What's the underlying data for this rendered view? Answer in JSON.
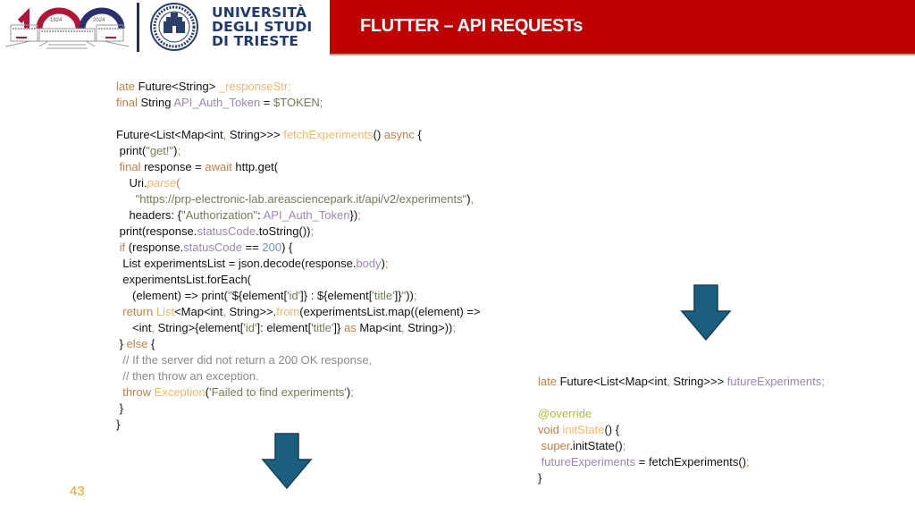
{
  "header": {
    "logo_years": {
      "start": "1924",
      "end": "2024"
    },
    "university_name": [
      "UNIVERSITÀ",
      "DEGLI STUDI",
      "DI TRIESTE"
    ],
    "slide_title": "FLUTTER – API REQUESTs",
    "title_bar_color": "#c00000"
  },
  "code_left": {
    "lines": [
      [
        {
          "t": "late",
          "c": "kw"
        },
        {
          "t": " Future<String> "
        },
        {
          "t": "_responseStr;",
          "c": "fn"
        }
      ],
      [
        {
          "t": "final",
          "c": "kw"
        },
        {
          "t": " String "
        },
        {
          "t": "API_Auth_Token",
          "c": "prop"
        },
        {
          "t": " = "
        },
        {
          "t": "$TOKEN;",
          "c": "str"
        }
      ],
      [
        {
          "t": ""
        }
      ],
      [
        {
          "t": "Future<List<Map<int"
        },
        {
          "t": ",",
          "c": "kw"
        },
        {
          "t": " String>>> "
        },
        {
          "t": "fetchExperiments",
          "c": "fn"
        },
        {
          "t": "() "
        },
        {
          "t": "async",
          "c": "kw"
        },
        {
          "t": " {"
        }
      ],
      [
        {
          "t": " print("
        },
        {
          "t": "\"get!\"",
          "c": "str"
        },
        {
          "t": ")"
        },
        {
          "t": ";",
          "c": "kw"
        }
      ],
      [
        {
          "t": " "
        },
        {
          "t": "final",
          "c": "kw"
        },
        {
          "t": " response = "
        },
        {
          "t": "await",
          "c": "kw"
        },
        {
          "t": " http.get("
        }
      ],
      [
        {
          "t": "    Uri."
        },
        {
          "t": "parse",
          "c": "fni"
        },
        {
          "t": "(",
          "c": "kw"
        }
      ],
      [
        {
          "t": "      "
        },
        {
          "t": "\"https://prp-electronic-lab.areasciencepark.it/api/v2/experiments\"",
          "c": "str"
        },
        {
          "t": ")"
        },
        {
          "t": ",",
          "c": "kw"
        }
      ],
      [
        {
          "t": "    headers: {"
        },
        {
          "t": "\"Authorization\"",
          "c": "str"
        },
        {
          "t": ": "
        },
        {
          "t": "API_Auth_Token",
          "c": "prop"
        },
        {
          "t": "})"
        },
        {
          "t": ";",
          "c": "kw"
        }
      ],
      [
        {
          "t": " print(response."
        },
        {
          "t": "statusCode",
          "c": "prop"
        },
        {
          "t": ".toString())"
        },
        {
          "t": ";",
          "c": "kw"
        }
      ],
      [
        {
          "t": " "
        },
        {
          "t": "if",
          "c": "kw"
        },
        {
          "t": " (response."
        },
        {
          "t": "statusCode",
          "c": "prop"
        },
        {
          "t": " == "
        },
        {
          "t": "200",
          "c": "num"
        },
        {
          "t": ") {"
        }
      ],
      [
        {
          "t": "  List experimentsList = json.decode(response."
        },
        {
          "t": "body",
          "c": "prop"
        },
        {
          "t": ")"
        },
        {
          "t": ";",
          "c": "kw"
        }
      ],
      [
        {
          "t": "  experimentsList.forEach("
        }
      ],
      [
        {
          "t": "     (element) => print("
        },
        {
          "t": "\"",
          "c": "str"
        },
        {
          "t": "${element["
        },
        {
          "t": "'id'",
          "c": "str"
        },
        {
          "t": "]} : ${element["
        },
        {
          "t": "'title'",
          "c": "str"
        },
        {
          "t": "]}"
        },
        {
          "t": "\"",
          "c": "str"
        },
        {
          "t": "))"
        },
        {
          "t": ";",
          "c": "kw"
        }
      ],
      [
        {
          "t": "  "
        },
        {
          "t": "return",
          "c": "kw"
        },
        {
          "t": " "
        },
        {
          "t": "List",
          "c": "fn"
        },
        {
          "t": "<Map<int"
        },
        {
          "t": ",",
          "c": "kw"
        },
        {
          "t": " String>>."
        },
        {
          "t": "from",
          "c": "fn"
        },
        {
          "t": "(experimentsList.map((element) =>"
        }
      ],
      [
        {
          "t": "     <int"
        },
        {
          "t": ",",
          "c": "kw"
        },
        {
          "t": " String>{element["
        },
        {
          "t": "'id'",
          "c": "str"
        },
        {
          "t": "]: element["
        },
        {
          "t": "'title'",
          "c": "str"
        },
        {
          "t": "]} "
        },
        {
          "t": "as",
          "c": "kw"
        },
        {
          "t": " Map<int"
        },
        {
          "t": ",",
          "c": "kw"
        },
        {
          "t": " String>))"
        },
        {
          "t": ";",
          "c": "kw"
        }
      ],
      [
        {
          "t": " } "
        },
        {
          "t": "else",
          "c": "kw"
        },
        {
          "t": " {"
        }
      ],
      [
        {
          "t": "  "
        },
        {
          "t": "// If the server did not return a 200 OK response,",
          "c": "cmt"
        }
      ],
      [
        {
          "t": "  "
        },
        {
          "t": "// then throw an exception.",
          "c": "cmt"
        }
      ],
      [
        {
          "t": "  "
        },
        {
          "t": "throw",
          "c": "kw"
        },
        {
          "t": " "
        },
        {
          "t": "Exception",
          "c": "fn"
        },
        {
          "t": "("
        },
        {
          "t": "'Failed to find experiments'",
          "c": "str"
        },
        {
          "t": ")"
        },
        {
          "t": ";",
          "c": "kw"
        }
      ],
      [
        {
          "t": " }"
        }
      ],
      [
        {
          "t": "}"
        }
      ]
    ]
  },
  "code_right": {
    "lines": [
      [
        {
          "t": "late",
          "c": "kw"
        },
        {
          "t": " Future<List<Map<int"
        },
        {
          "t": ",",
          "c": "kw"
        },
        {
          "t": " String>>> "
        },
        {
          "t": "futureExperiments;",
          "c": "prop"
        }
      ],
      [
        {
          "t": ""
        }
      ],
      [
        {
          "t": "@override",
          "c": "ann"
        }
      ],
      [
        {
          "t": "void",
          "c": "kw"
        },
        {
          "t": " "
        },
        {
          "t": "initState",
          "c": "fn"
        },
        {
          "t": "() {"
        }
      ],
      [
        {
          "t": " "
        },
        {
          "t": "super",
          "c": "kw"
        },
        {
          "t": ".initState()"
        },
        {
          "t": ";",
          "c": "kw"
        }
      ],
      [
        {
          "t": " "
        },
        {
          "t": "futureExperiments",
          "c": "prop"
        },
        {
          "t": " = fetchExperiments()"
        },
        {
          "t": ";",
          "c": "kw"
        }
      ],
      [
        {
          "t": "}"
        }
      ]
    ]
  },
  "arrows": [
    {
      "name": "down-arrow-right",
      "direction": "down",
      "color": "#1b5e7e"
    },
    {
      "name": "down-arrow-left",
      "direction": "down",
      "color": "#1b5e7e"
    }
  ],
  "footer": {
    "page_number": "43"
  }
}
